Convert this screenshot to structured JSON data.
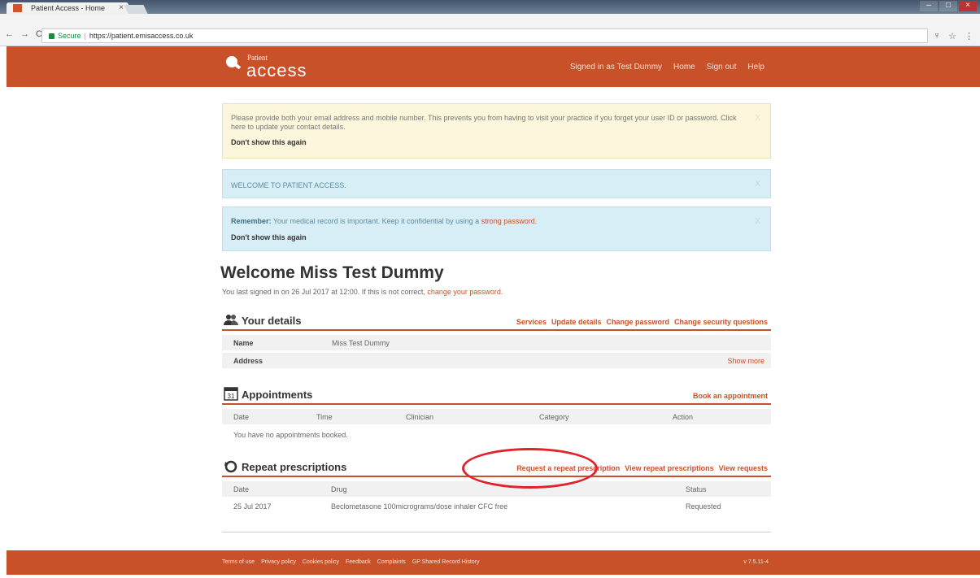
{
  "browser": {
    "tab_title": "Patient Access - Home",
    "tab_close": "×",
    "secure_label": "Secure",
    "url": "https://patient.emisaccess.co.uk"
  },
  "header": {
    "logo_small": "Patient",
    "logo_big": "access",
    "signed_in": "Signed in as Test Dummy",
    "nav": [
      "Home",
      "Sign out",
      "Help"
    ]
  },
  "alerts": {
    "email": {
      "text": "Please provide both your email address and mobile number. This prevents you from having to visit your practice if you forget your user ID or password. Click here to update your contact details.",
      "dont_show": "Don't show this again",
      "close": "X"
    },
    "welcome": {
      "text": "WELCOME TO PATIENT ACCESS.",
      "close": "X"
    },
    "remember": {
      "label": "Remember:",
      "text": " Your medical record is important. Keep it confidential by using a ",
      "link": "strong password",
      "end": ".",
      "dont_show": "Don't show this again",
      "close": "X"
    }
  },
  "welcome": {
    "title": "Welcome Miss Test Dummy",
    "last_signed": "You last signed in on 26 Jul 2017 at 12:00. If this is not correct, ",
    "change_password_link": "change your password",
    "end": "."
  },
  "your_details": {
    "title": "Your details",
    "links": [
      "Services",
      "Update details",
      "Change password",
      "Change security questions"
    ],
    "name_label": "Name",
    "name_value": "Miss Test Dummy",
    "address_label": "Address",
    "show_more": "Show more"
  },
  "appointments": {
    "title": "Appointments",
    "book_link": "Book an appointment",
    "columns": [
      "Date",
      "Time",
      "Clinician",
      "Category",
      "Action"
    ],
    "empty": "You have no appointments booked."
  },
  "prescriptions": {
    "title": "Repeat prescriptions",
    "links": [
      "Request a repeat prescription",
      "View repeat prescriptions",
      "View requests"
    ],
    "columns": [
      "Date",
      "Drug",
      "Status"
    ],
    "rows": [
      {
        "date": "25 Jul 2017",
        "drug": "Beclometasone 100micrograms/dose inhaler CFC free",
        "status": "Requested"
      }
    ]
  },
  "footer": {
    "links": [
      "Terms of use",
      "Privacy policy",
      "Cookies policy",
      "Feedback",
      "Complaints",
      "GP Shared Record History"
    ],
    "version": "v 7.5.11-4"
  },
  "colors": {
    "brand": "#c9512a",
    "highlight": "#e0232a"
  }
}
